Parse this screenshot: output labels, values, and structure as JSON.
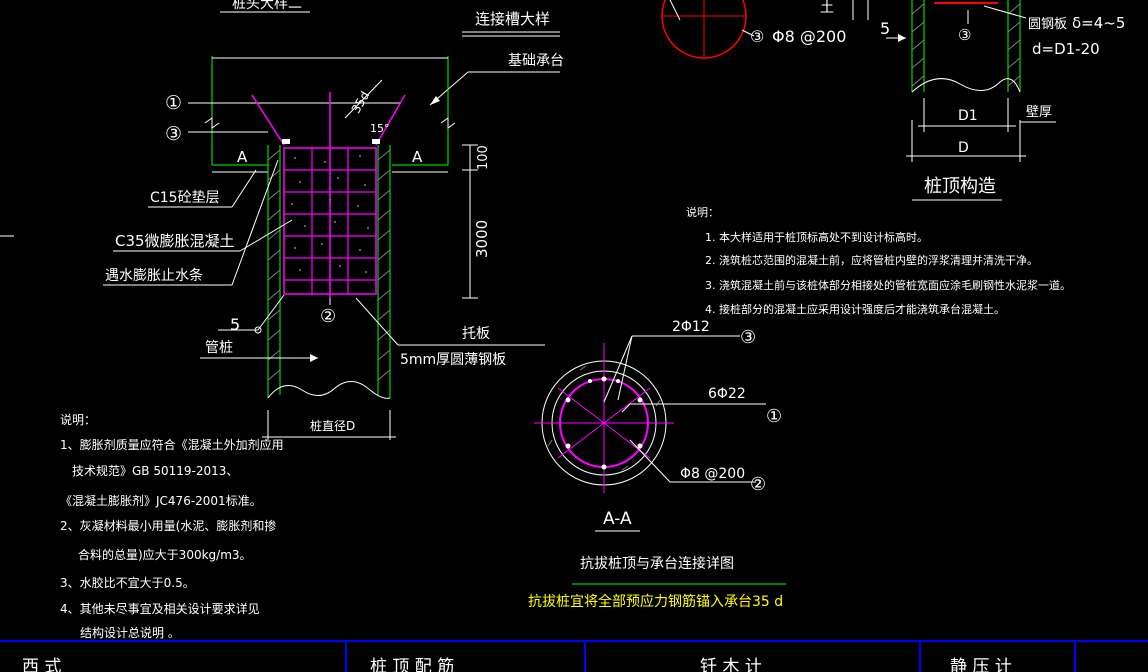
{
  "colors": {
    "bg": "#000000",
    "white": "#ffffff",
    "green": "#00ff00",
    "magenta": "#ff00ff",
    "red": "#ff0000",
    "yellow": "#ffff00",
    "cyan": "#00ffff",
    "blue": "#0000ff",
    "grey": "#808080"
  },
  "left_detail": {
    "title_partial": "桩头大样二",
    "groove_title": "连接槽大样",
    "base_cap": "基础承台",
    "circle_1": "①",
    "circle_3": "③",
    "circle_2": "②",
    "section_a": "A",
    "dim_35d": "35d",
    "dim_15deg": "15°",
    "dim_100": "100",
    "dim_3000": "3000",
    "c15": "C15砼垫层",
    "c35": "C35微膨胀混凝土",
    "water_stop": "遇水膨胀止水条",
    "dim_5": "5",
    "pipe_pile": "管桩",
    "tuo_ban": "托板",
    "plate_5mm": "5mm厚圆薄钢板",
    "pile_dia": "桩直径D",
    "notes_title": "说明：",
    "notes": [
      "1、膨胀剂质量应符合《混凝土外加剂应用",
      "技术规范》GB 50119-2013、",
      "《混凝土膨胀剂》JC476-2001标准。",
      "2、灰凝材料最小用量(水泥、膨胀剂和掺",
      "合料的总量)应大于300kg/m3。",
      "3、水胶比不宜大于0.5。",
      "4、其他未尽事宜及相关设计要求详见",
      "结构设计总说明  。"
    ]
  },
  "top_mid": {
    "circle_3": "③",
    "rebar": "Φ8 @200"
  },
  "right_detail": {
    "dim_5": "5",
    "circle_3": "③",
    "plate_label": "圆钢板",
    "delta": "δ=4~5",
    "d_formula": "d=D1-20",
    "d1": "D1",
    "wall": "壁厚",
    "d": "D",
    "title": "桩顶构造",
    "notes_title": "说明：",
    "notes": [
      "1. 本大样适用于桩顶标高处不到设计标高时。",
      "2. 浇筑桩芯范围的混凝土前，应将管桩内壁的浮浆清理并清洗干净。",
      "3. 浇筑混凝土前与该桩体部分相接处的管桩宽面应涂毛刷钢性水泥浆一道。",
      "4. 接桩部分的混凝土应采用设计强度后才能浇筑承台混凝土。"
    ]
  },
  "section": {
    "r1": "2Φ12",
    "c3": "③",
    "r2": "6Φ22",
    "c1": "①",
    "r3": "Φ8 @200",
    "c2": "②",
    "label": "A-A",
    "title": "抗拔桩顶与承台连接详图",
    "note": "抗拔桩宜将全部预应力钢筋锚入承台35 d"
  },
  "footer": {
    "cells": [
      "西  式",
      "桩  顶  配  筋",
      "钎  木  计",
      "静  压  计"
    ]
  }
}
